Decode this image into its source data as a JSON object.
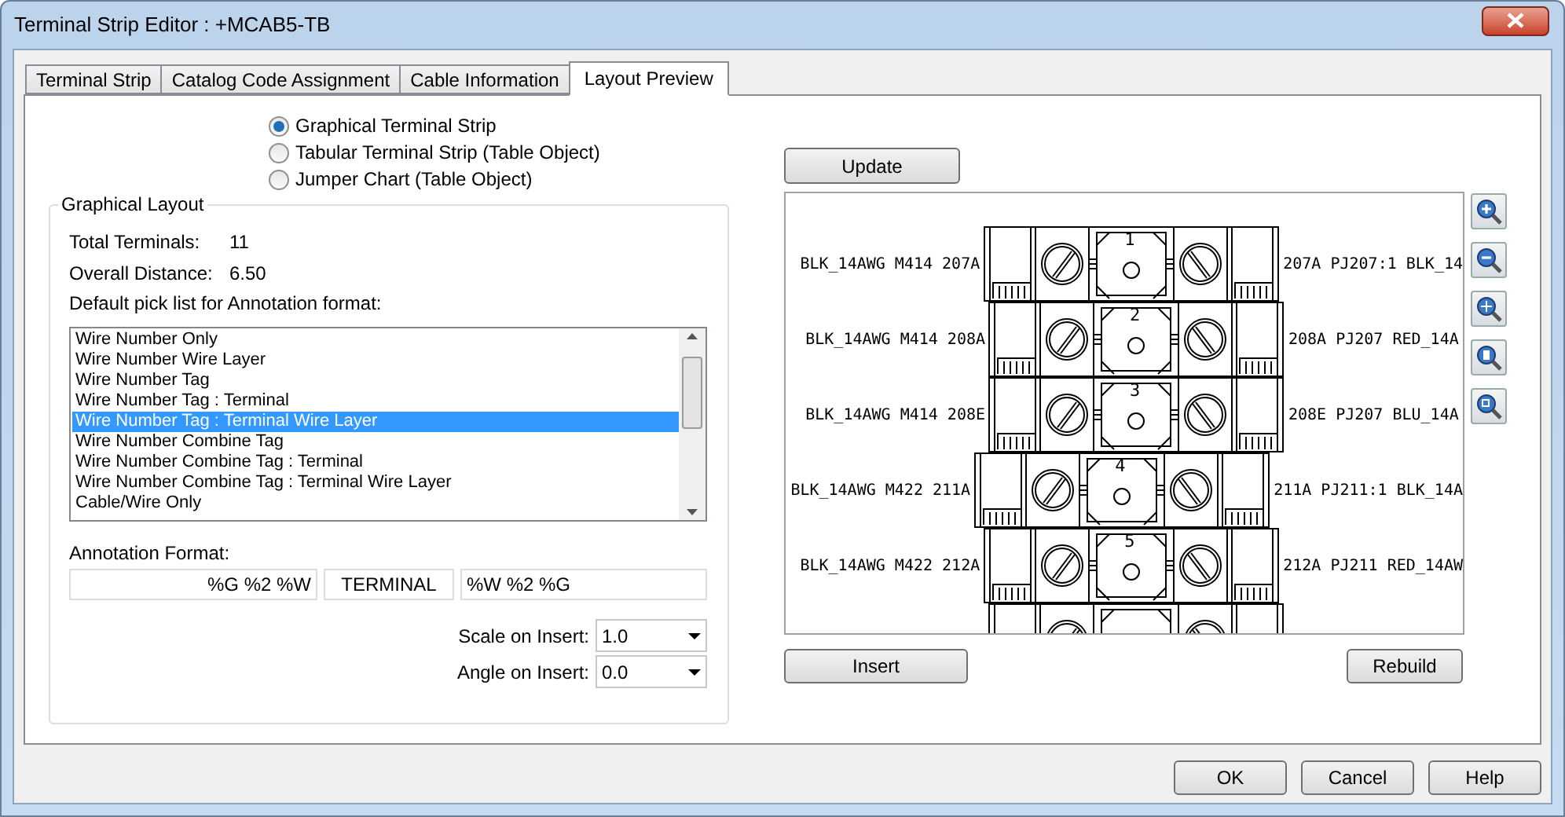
{
  "window": {
    "title": "Terminal Strip Editor : +MCAB5-TB"
  },
  "tabs": [
    {
      "label": "Terminal Strip",
      "selected": false
    },
    {
      "label": "Catalog Code Assignment",
      "selected": false
    },
    {
      "label": "Cable Information",
      "selected": false
    },
    {
      "label": "Layout Preview",
      "selected": true
    }
  ],
  "output_options": [
    {
      "label": "Graphical Terminal Strip",
      "selected": true
    },
    {
      "label": "Tabular Terminal Strip (Table Object)",
      "selected": false
    },
    {
      "label": "Jumper Chart (Table Object)",
      "selected": false
    }
  ],
  "graphical_layout": {
    "title": "Graphical Layout",
    "fields": [
      {
        "label": "Total Terminals:",
        "value": "11"
      },
      {
        "label": "Overall Distance:",
        "value": "6.50"
      }
    ],
    "pick_list_label": "Default pick list for Annotation format:",
    "pick_list": [
      {
        "label": "Wire Number Only",
        "selected": false
      },
      {
        "label": "Wire Number Wire Layer",
        "selected": false
      },
      {
        "label": "Wire Number Tag",
        "selected": false
      },
      {
        "label": "Wire Number Tag : Terminal",
        "selected": false
      },
      {
        "label": "Wire Number Tag : Terminal Wire Layer",
        "selected": true
      },
      {
        "label": "Wire Number Combine Tag",
        "selected": false
      },
      {
        "label": "Wire Number Combine Tag : Terminal",
        "selected": false
      },
      {
        "label": "Wire Number Combine Tag : Terminal Wire Layer",
        "selected": false
      },
      {
        "label": "Cable/Wire Only",
        "selected": false
      }
    ],
    "annotation_label": "Annotation Format:",
    "annotation": {
      "left": "%G %2 %W",
      "middle": "TERMINAL",
      "right": "%W %2 %G"
    },
    "scale": {
      "label": "Scale on Insert:",
      "value": "1.0"
    },
    "angle": {
      "label": "Angle on Insert:",
      "value": "0.0"
    }
  },
  "preview": {
    "update_button": "Update",
    "terminals": [
      {
        "number": "1",
        "left": "BLK_14AWG M414 207A",
        "right": "207A PJ207:1 BLK_14"
      },
      {
        "number": "2",
        "left": "BLK_14AWG M414 208A",
        "right": "208A PJ207 RED_14A"
      },
      {
        "number": "3",
        "left": "BLK_14AWG M414 208E",
        "right": "208E PJ207 BLU_14A"
      },
      {
        "number": "4",
        "left": "BLK_14AWG M422 211A",
        "right": "211A PJ211:1 BLK_14A"
      },
      {
        "number": "5",
        "left": "BLK_14AWG M422 212A",
        "right": "212A PJ211 RED_14AW"
      }
    ],
    "insert_button": "Insert",
    "rebuild_button": "Rebuild"
  },
  "buttons": [
    "OK",
    "Cancel",
    "Help"
  ]
}
